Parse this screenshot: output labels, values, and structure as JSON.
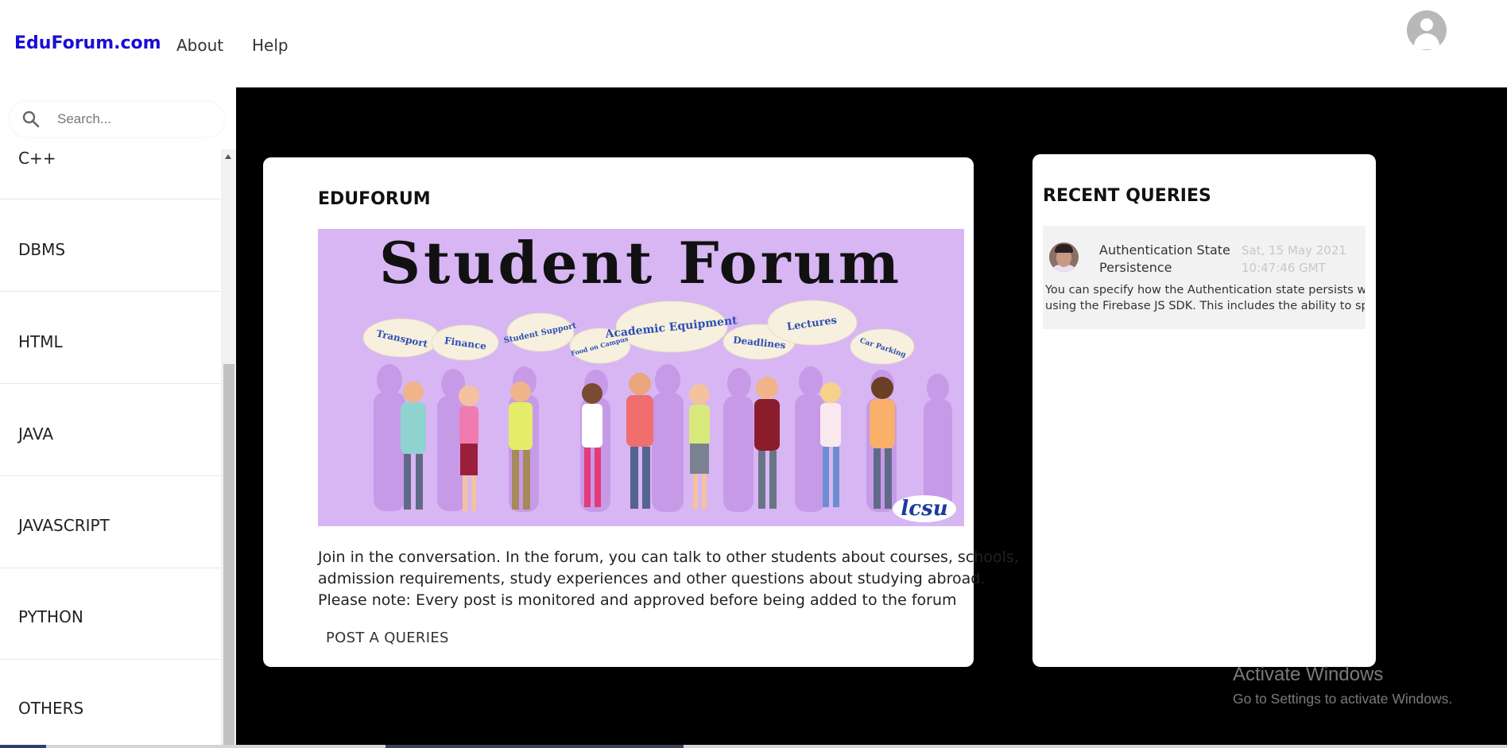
{
  "header": {
    "brand": "EduForum.com",
    "nav": [
      {
        "label": "About"
      },
      {
        "label": "Help"
      }
    ],
    "user_icon": "account-circle-icon"
  },
  "sidebar": {
    "search": {
      "placeholder": "Search...",
      "value": "",
      "icon": "search-icon"
    },
    "topics": [
      {
        "label": "C++"
      },
      {
        "label": "DBMS"
      },
      {
        "label": "HTML"
      },
      {
        "label": "JAVA"
      },
      {
        "label": "JAVASCRIPT"
      },
      {
        "label": "PYTHON"
      },
      {
        "label": "OTHERS"
      }
    ]
  },
  "main": {
    "title": "EDUFORUM",
    "banner": {
      "heading": "Student Forum",
      "bubbles": [
        "Transport",
        "Finance",
        "Student Support",
        "Food on Campus",
        "Academic Equipment",
        "Deadlines",
        "Lectures",
        "Car Parking"
      ],
      "logo": "lcsu"
    },
    "intro_lines": [
      "Join in the conversation. In the forum, you can talk to other students about courses, schools,",
      "admission requirements, study experiences and other questions about studying abroad.",
      "Please note: Every post is monitored and approved before being added to the forum"
    ],
    "post_button": "POST A QUERIES"
  },
  "recent": {
    "title": "RECENT QUERIES",
    "items": [
      {
        "title": "Authentication State Persistence",
        "date": "Sat, 15 May 2021 10:47:46 GMT",
        "excerpt_lines": [
          "You can specify how the Authentication state persists when",
          "using the Firebase JS SDK. This includes the ability to speci..."
        ]
      }
    ]
  },
  "watermark": {
    "title": "Activate Windows",
    "subtitle": "Go to Settings to activate Windows."
  },
  "colors": {
    "brand": "#1a0dd6",
    "page_background": "#000000",
    "banner_background": "#d7b6f3"
  }
}
